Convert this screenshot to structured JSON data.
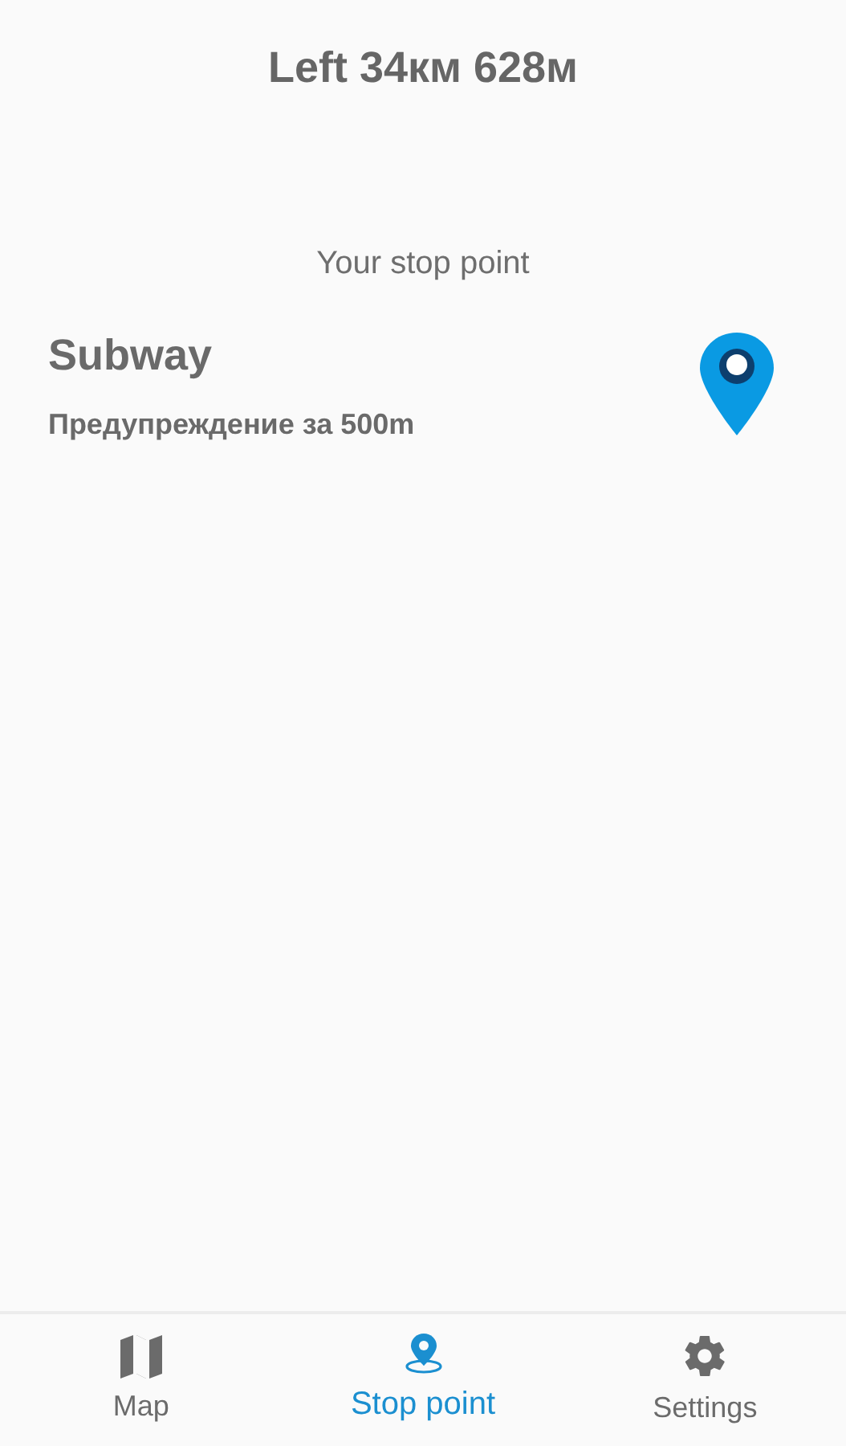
{
  "header": {
    "title": "Left 34км 628м"
  },
  "section_label": "Your stop point",
  "stop": {
    "name": "Subway",
    "warning": "Предупреждение за 500m"
  },
  "tabs": [
    {
      "kind": "map",
      "label": "Map",
      "selected": false
    },
    {
      "kind": "stop",
      "label": "Stop point",
      "selected": true
    },
    {
      "kind": "settings",
      "label": "Settings",
      "selected": false
    }
  ]
}
